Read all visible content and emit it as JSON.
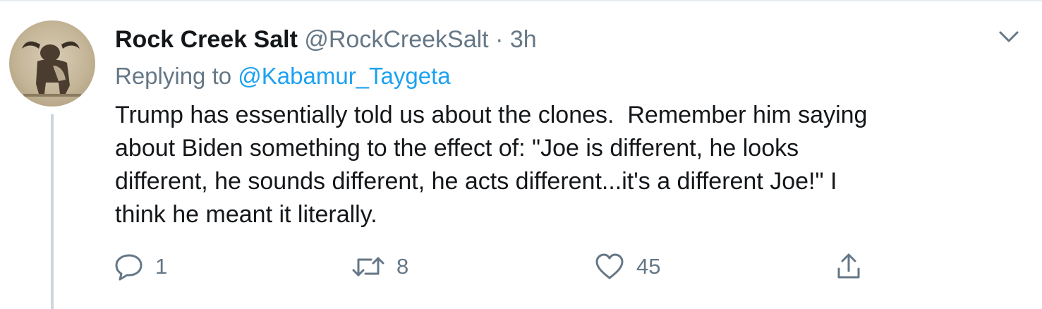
{
  "tweet": {
    "display_name": "Rock Creek Salt",
    "handle": "@RockCreekSalt",
    "separator": "·",
    "timestamp": "3h",
    "replying_prefix": "Replying to",
    "replying_to": "@Kabamur_Taygeta",
    "text": "Trump has essentially told us about the clones.  Remember him saying\nabout Biden something to the effect of: \"Joe is different, he looks\ndifferent, he sounds different, he acts different...it's a different Joe!\" I\nthink he meant it literally.",
    "icons": {
      "menu": "chevron-down-icon",
      "reply": "reply-icon",
      "retweet": "retweet-icon",
      "like": "heart-icon",
      "share": "share-icon"
    }
  },
  "actions": {
    "reply_count": "1",
    "retweet_count": "8",
    "like_count": "45"
  },
  "colors": {
    "text_primary": "#14171a",
    "text_secondary": "#657786",
    "link": "#1da1f2",
    "thread_line": "#ccd6dd"
  }
}
